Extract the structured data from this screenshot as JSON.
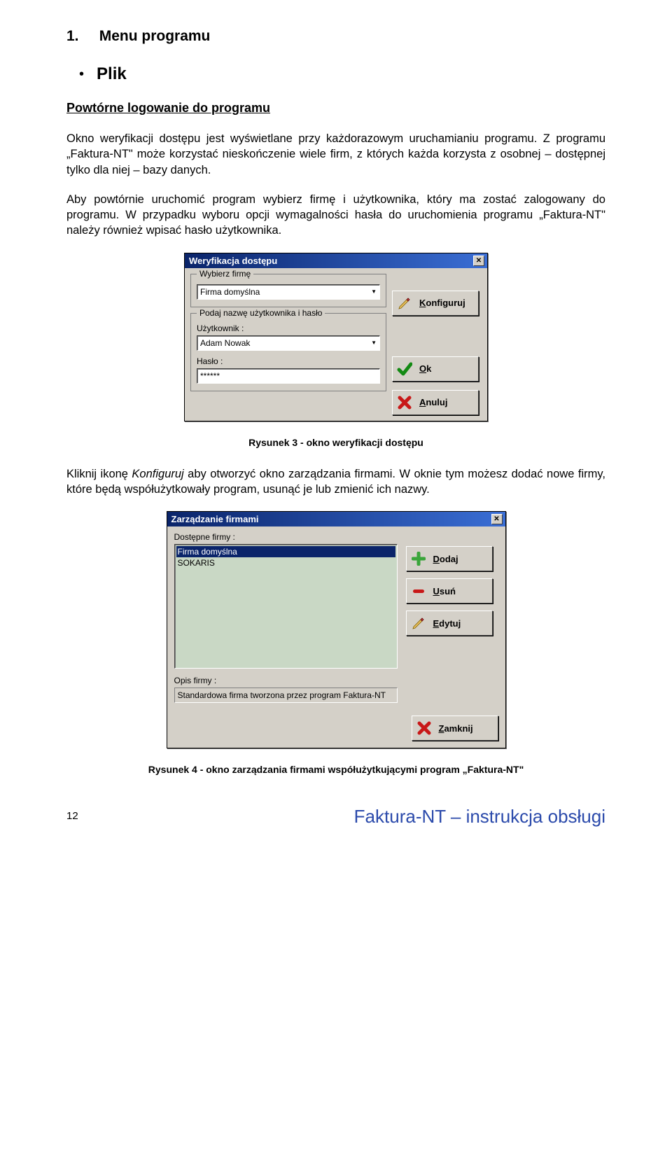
{
  "section_number": "1.",
  "section_title": "Menu programu",
  "bullet_heading": "Plik",
  "sub_heading": "Powtórne logowanie do programu",
  "para1": "Okno weryfikacji dostępu jest wyświetlane przy każdorazowym uruchamianiu programu. Z programu „Faktura-NT\" może korzystać nieskończenie wiele firm, z których każda korzysta z osobnej – dostępnej tylko dla niej – bazy danych.",
  "para2": "Aby powtórnie uruchomić program wybierz firmę i użytkownika, który ma zostać zalogowany do programu. W przypadku wyboru opcji wymagalności hasła do uruchomienia programu „Faktura-NT\" należy również wpisać hasło użytkownika.",
  "dialog1": {
    "title": "Weryfikacja dostępu",
    "field1_legend": "Wybierz firmę",
    "combo_value": "Firma domyślna",
    "field2_legend": "Podaj nazwę użytkownika i hasło",
    "user_label": "Użytkownik :",
    "user_value": "Adam Nowak",
    "pass_label": "Hasło :",
    "pass_value": "******",
    "btn_config_u": "K",
    "btn_config_r": "onfiguruj",
    "btn_ok_u": "O",
    "btn_ok_r": "k",
    "btn_cancel_u": "A",
    "btn_cancel_r": "nuluj"
  },
  "caption1": "Rysunek 3 - okno weryfikacji dostępu",
  "para3": "Kliknij ikonę Konfiguruj aby otworzyć okno zarządzania firmami. W oknie tym możesz dodać nowe firmy, które będą współużytkowały program, usunąć je lub zmienić ich nazwy.",
  "dialog2": {
    "title": "Zarządzanie firmami",
    "list_label": "Dostępne firmy :",
    "items": [
      "Firma domyślna",
      "SOKARIS"
    ],
    "desc_label": "Opis firmy :",
    "desc_value": "Standardowa firma tworzona przez program Faktura-NT",
    "btn_add_u": "D",
    "btn_add_r": "odaj",
    "btn_del_u": "U",
    "btn_del_r": "suń",
    "btn_edit_u": "E",
    "btn_edit_r": "dytuj",
    "btn_close_u": "Z",
    "btn_close_r": "amknij"
  },
  "caption2": "Rysunek 4 - okno zarządzania firmami współużytkującymi program „Faktura-NT\"",
  "page_number": "12",
  "footer": "Faktura-NT – instrukcja obsługi"
}
